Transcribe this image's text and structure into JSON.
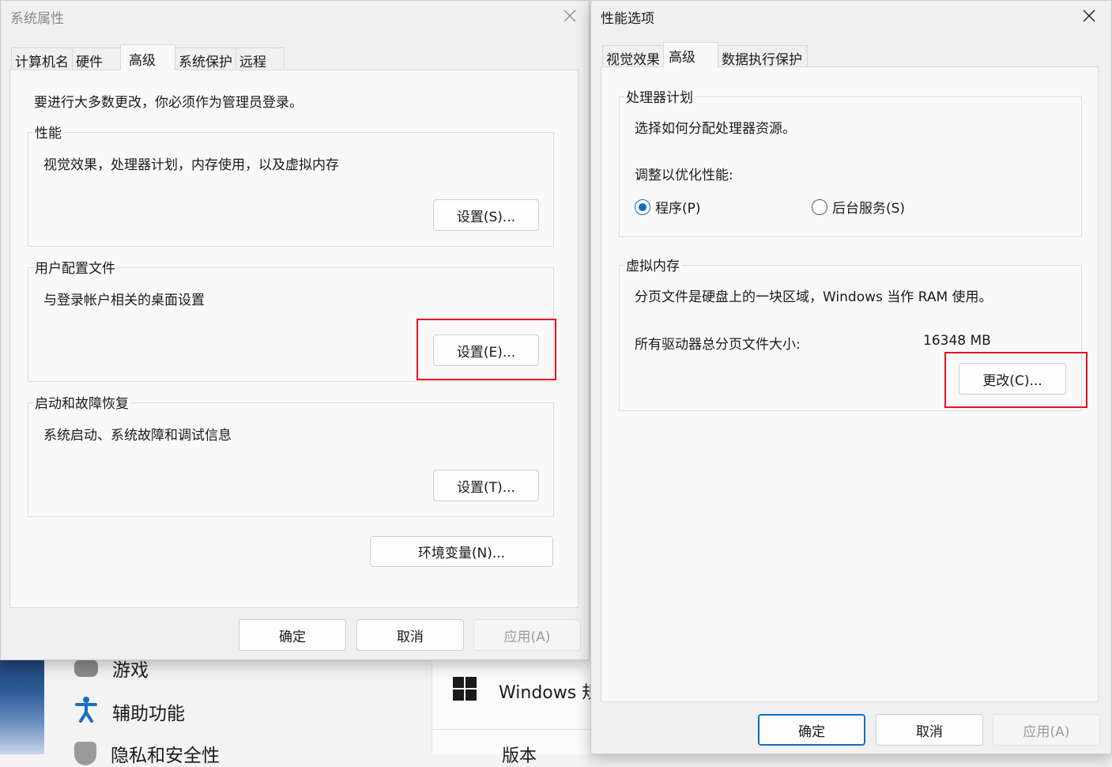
{
  "background": {
    "items": [
      {
        "label": "游戏"
      },
      {
        "label": "辅助功能"
      },
      {
        "label": "隐私和安全性"
      }
    ],
    "card": {
      "windows_label": "Windows 规",
      "version_label": "版本"
    }
  },
  "sysprops": {
    "title": "系统属性",
    "tabs": [
      "计算机名",
      "硬件",
      "高级",
      "系统保护",
      "远程"
    ],
    "active_tab": "高级",
    "admin_note": "要进行大多数更改，你必须作为管理员登录。",
    "groups": {
      "performance": {
        "title": "性能",
        "desc": "视觉效果，处理器计划，内存使用，以及虚拟内存",
        "button": "设置(S)..."
      },
      "profiles": {
        "title": "用户配置文件",
        "desc": "与登录帐户相关的桌面设置",
        "button": "设置(E)..."
      },
      "startup": {
        "title": "启动和故障恢复",
        "desc": "系统启动、系统故障和调试信息",
        "button": "设置(T)..."
      }
    },
    "env_button": "环境变量(N)...",
    "ok": "确定",
    "cancel": "取消",
    "apply": "应用(A)"
  },
  "perfopts": {
    "title": "性能选项",
    "tabs": [
      "视觉效果",
      "高级",
      "数据执行保护"
    ],
    "active_tab": "高级",
    "processor": {
      "title": "处理器计划",
      "desc": "选择如何分配处理器资源。",
      "adjust_label": "调整以优化性能:",
      "options": [
        {
          "label": "程序(P)",
          "checked": true
        },
        {
          "label": "后台服务(S)",
          "checked": false
        }
      ]
    },
    "virtual_memory": {
      "title": "虚拟内存",
      "desc": "分页文件是硬盘上的一块区域，Windows 当作 RAM 使用。",
      "total_label": "所有驱动器总分页文件大小:",
      "total_value": "16348 MB",
      "change_button": "更改(C)..."
    },
    "ok": "确定",
    "cancel": "取消",
    "apply": "应用(A)"
  },
  "colors": {
    "highlight": "#e81123",
    "accent": "#0f6cbd"
  }
}
